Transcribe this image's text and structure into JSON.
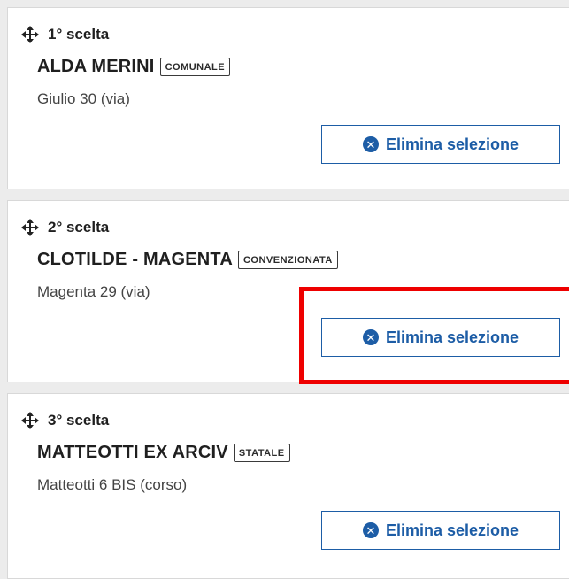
{
  "choices": [
    {
      "choice_label": "1° scelta",
      "school_name": "ALDA MERINI",
      "school_type": "COMUNALE",
      "address": "Giulio 30 (via)",
      "delete_label": "Elimina selezione"
    },
    {
      "choice_label": "2° scelta",
      "school_name": "CLOTILDE - MAGENTA",
      "school_type": "CONVENZIONATA",
      "address": "Magenta 29 (via)",
      "delete_label": "Elimina selezione"
    },
    {
      "choice_label": "3° scelta",
      "school_name": "MATTEOTTI EX ARCIV",
      "school_type": "STATALE",
      "address": "Matteotti 6 BIS (corso)",
      "delete_label": "Elimina selezione"
    }
  ],
  "icons": {
    "move": "move-arrows-icon",
    "delete": "close-circle-icon"
  },
  "colors": {
    "accent": "#1d5da6",
    "highlight": "#ee0000",
    "card_border": "#d8d8d8"
  }
}
